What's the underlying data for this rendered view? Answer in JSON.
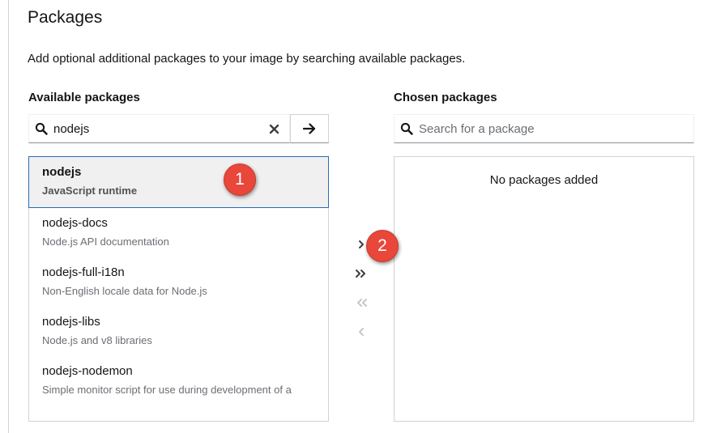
{
  "section": {
    "title": "Packages",
    "description": "Add optional additional packages to your image by searching available packages."
  },
  "available": {
    "label": "Available packages",
    "search_value": "nodejs",
    "items": [
      {
        "name": "nodejs",
        "description": "JavaScript runtime",
        "selected": true
      },
      {
        "name": "nodejs-docs",
        "description": "Node.js API documentation"
      },
      {
        "name": "nodejs-full-i18n",
        "description": "Non-English locale data for Node.js"
      },
      {
        "name": "nodejs-libs",
        "description": "Node.js and v8 libraries"
      },
      {
        "name": "nodejs-nodemon",
        "description": "Simple monitor script for use during development of a"
      }
    ]
  },
  "chosen": {
    "label": "Chosen packages",
    "search_placeholder": "Search for a package",
    "empty_text": "No packages added"
  },
  "controls": {
    "add_selected": "chevron-right-icon",
    "add_all": "double-chevron-right-icon",
    "remove_all": "double-chevron-left-icon",
    "remove_selected": "chevron-left-icon"
  },
  "annotations": {
    "badge1": "1",
    "badge2": "2",
    "color": "#e8473a"
  }
}
